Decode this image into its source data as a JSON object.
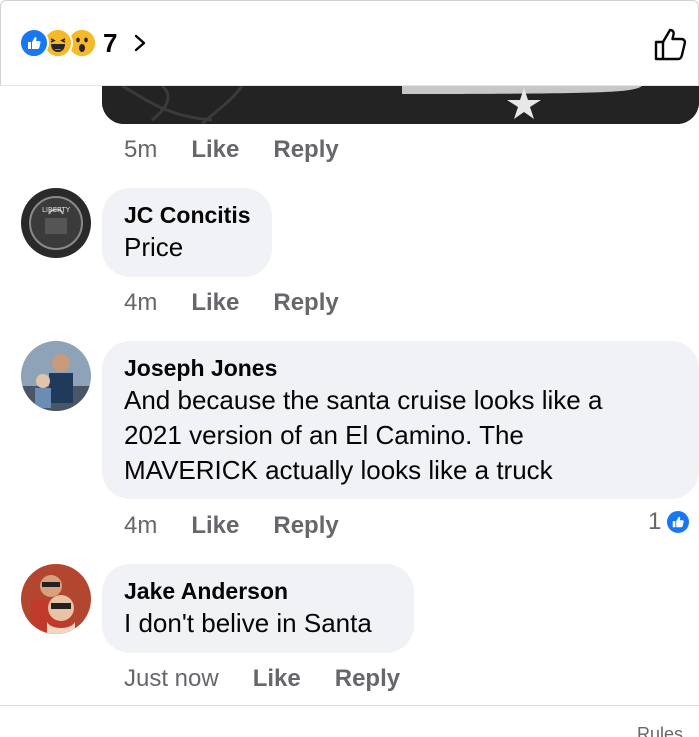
{
  "header": {
    "reaction_icons": [
      "like-reaction-icon",
      "haha-reaction-icon",
      "wow-reaction-icon"
    ],
    "reaction_count": "7",
    "chevron_icon": "chevron-right-icon",
    "like_icon": "thumbs-up-outline-icon"
  },
  "first_comment_actions": {
    "time": "5m",
    "like": "Like",
    "reply": "Reply"
  },
  "comments": [
    {
      "author": "JC Concitis",
      "text": "Price",
      "time": "4m",
      "like": "Like",
      "reply": "Reply"
    },
    {
      "author": "Joseph Jones",
      "text_lines": [
        "And because the santa cruise looks like a",
        "2021 version of an El Camino. The",
        "MAVERICK actually looks like a truck"
      ],
      "time": "4m",
      "like": "Like",
      "reply": "Reply",
      "like_count": "1"
    },
    {
      "author": "Jake Anderson",
      "text": "I don't belive in Santa",
      "time": "Just now",
      "like": "Like",
      "reply": "Reply"
    }
  ],
  "footer": {
    "rules": "Rules"
  },
  "colors": {
    "facebook_blue": "#1877f2",
    "bubble_bg": "#f0f2f5",
    "meta_text": "#65676b"
  }
}
